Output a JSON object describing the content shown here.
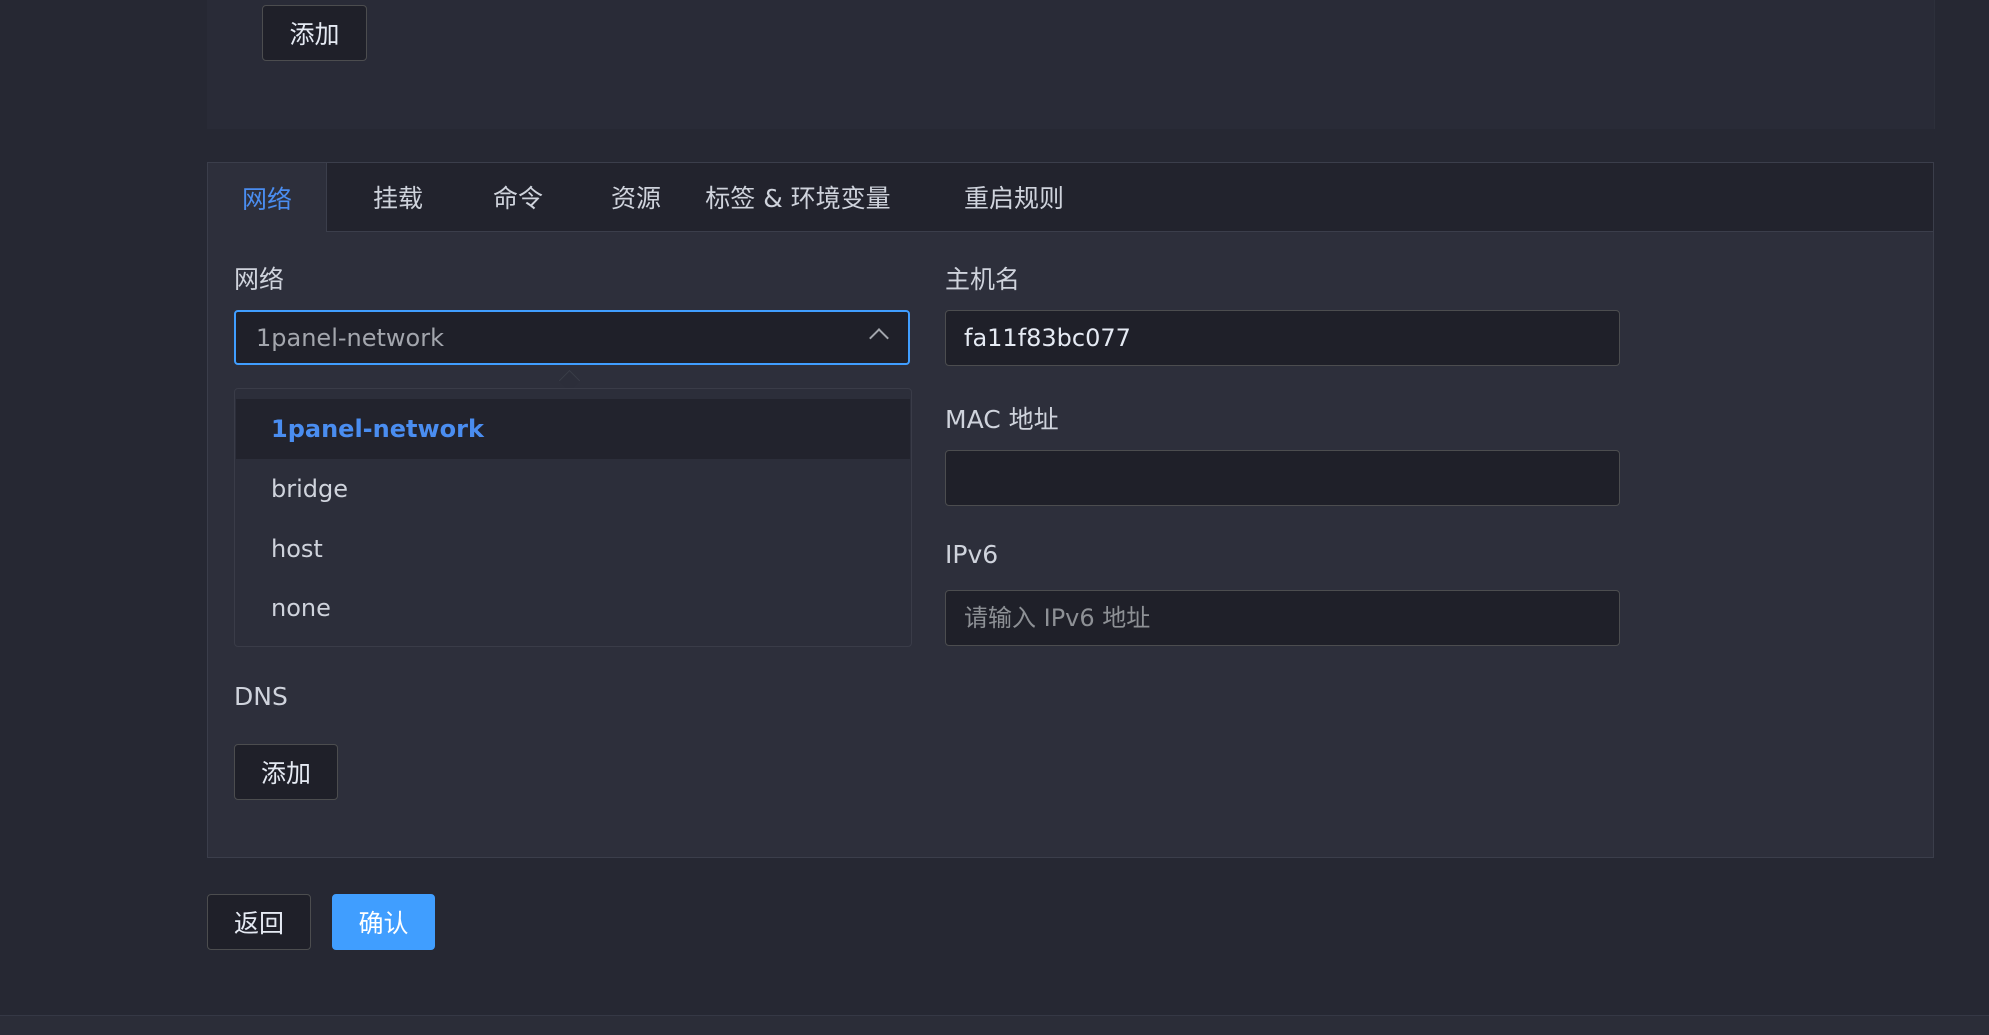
{
  "top_section": {
    "add_label": "添加"
  },
  "tabs": [
    {
      "label": "网络"
    },
    {
      "label": "挂载"
    },
    {
      "label": "命令"
    },
    {
      "label": "资源"
    },
    {
      "label": "标签 & 环境变量"
    },
    {
      "label": "重启规则"
    }
  ],
  "network": {
    "label": "网络",
    "selected": "1panel-network",
    "options": [
      "1panel-network",
      "bridge",
      "host",
      "none"
    ]
  },
  "hostname": {
    "label": "主机名",
    "value": "fa11f83bc077"
  },
  "mac": {
    "label": "MAC 地址",
    "value": ""
  },
  "ipv6": {
    "label": "IPv6",
    "placeholder": "请输入 IPv6 地址"
  },
  "dns": {
    "label": "DNS",
    "add_label": "添加"
  },
  "footer": {
    "back_label": "返回",
    "confirm_label": "确认"
  }
}
